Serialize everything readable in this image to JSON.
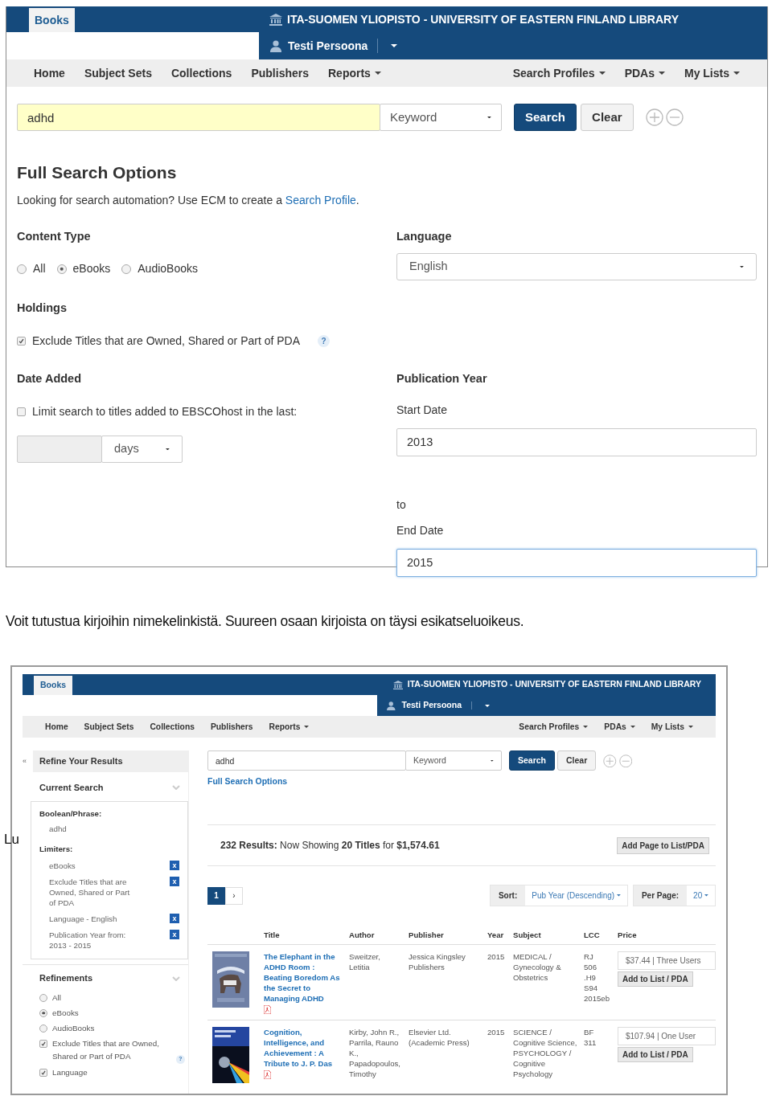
{
  "screen_1": {
    "header": {
      "tab": "Books",
      "library": "ITA-SUOMEN YLIOPISTO - UNIVERSITY OF EASTERN FINLAND LIBRARY",
      "user": "Testi Persoona"
    },
    "nav": {
      "left": [
        {
          "label": "Home",
          "dropdown": false
        },
        {
          "label": "Subject Sets",
          "dropdown": false
        },
        {
          "label": "Collections",
          "dropdown": false
        },
        {
          "label": "Publishers",
          "dropdown": false
        },
        {
          "label": "Reports",
          "dropdown": true
        }
      ],
      "right": [
        {
          "label": "Search Profiles",
          "dropdown": true
        },
        {
          "label": "PDAs",
          "dropdown": true
        },
        {
          "label": "My Lists",
          "dropdown": true
        }
      ]
    },
    "search": {
      "value": "adhd",
      "highlighted": true,
      "field_type": "Keyword",
      "search_button": "Search",
      "clear_button": "Clear"
    },
    "heading": "Full Search Options",
    "intro": "Looking for search automation? Use ECM to create a ",
    "intro_link": "Search Profile",
    "intro_end": ".",
    "content_type": {
      "label": "Content Type",
      "options": [
        {
          "label": "All",
          "selected": false
        },
        {
          "label": "eBooks",
          "selected": true
        },
        {
          "label": "AudioBooks",
          "selected": false
        }
      ]
    },
    "language": {
      "label": "Language",
      "value": "English"
    },
    "holdings": {
      "label": "Holdings",
      "option": {
        "label": "Exclude Titles that are Owned, Shared or Part of PDA",
        "checked": true
      },
      "help": "?"
    },
    "date_added": {
      "label": "Date Added",
      "option": {
        "label": "Limit search to titles added to EBSCOhost in the last:",
        "checked": false
      },
      "unit": "days"
    },
    "publication_year": {
      "label": "Publication Year",
      "start_label": "Start Date",
      "start": "2013",
      "to": "to",
      "end_label": "End Date",
      "end": "2015",
      "end_focused": true
    }
  },
  "caption": "Voit tutustua kirjoihin nimekelinkistä. Suureen osaan kirjoista on täysi esikatseluoikeus.",
  "stray_text": "Lu",
  "screen_2": {
    "header": {
      "tab": "Books",
      "library": "ITA-SUOMEN YLIOPISTO - UNIVERSITY OF EASTERN FINLAND LIBRARY",
      "user": "Testi Persoona"
    },
    "nav": {
      "left": [
        {
          "label": "Home",
          "dropdown": false
        },
        {
          "label": "Subject Sets",
          "dropdown": false
        },
        {
          "label": "Collections",
          "dropdown": false
        },
        {
          "label": "Publishers",
          "dropdown": false
        },
        {
          "label": "Reports",
          "dropdown": true
        }
      ],
      "right": [
        {
          "label": "Search Profiles",
          "dropdown": true
        },
        {
          "label": "PDAs",
          "dropdown": true
        },
        {
          "label": "My Lists",
          "dropdown": true
        }
      ]
    },
    "sidebar": {
      "collapse": "«",
      "title": "Refine Your Results",
      "current_search": "Current Search",
      "boolean_label": "Boolean/Phrase:",
      "boolean_value": "adhd",
      "limiters_label": "Limiters:",
      "limiters": [
        {
          "label": "eBooks",
          "remove": "x"
        },
        {
          "label": "Exclude Titles that are Owned, Shared or Part of PDA",
          "remove": "x"
        },
        {
          "label": "Language - English",
          "remove": "x"
        },
        {
          "label": "Publication Year from: 2013 - 2015",
          "remove": "x"
        }
      ],
      "refinements": "Refinements",
      "options": [
        {
          "kind": "radio",
          "label": "All",
          "selected": false
        },
        {
          "kind": "radio",
          "label": "eBooks",
          "selected": true
        },
        {
          "kind": "radio",
          "label": "AudioBooks",
          "selected": false
        },
        {
          "kind": "checkbox",
          "label": "Exclude Titles that are Owned, Shared or Part of PDA",
          "checked": true,
          "help": "?"
        },
        {
          "kind": "checkbox",
          "label": "Language",
          "checked": true
        }
      ]
    },
    "search": {
      "value": "adhd",
      "highlighted": false,
      "field_type": "Keyword",
      "search_button": "Search",
      "clear_button": "Clear"
    },
    "full_search_link": "Full Search Options",
    "summary": "**232 Results:** Now Showing **20 Titles** for **$1,574.61**",
    "add_page": "Add Page to List/PDA",
    "pagination": {
      "pages": [
        {
          "label": "1",
          "selected": true
        }
      ],
      "next": "›"
    },
    "sort": {
      "label": "Sort:",
      "value": "Pub Year (Descending)",
      "per_page_label": "Per Page:",
      "per_page": "20"
    },
    "columns": [
      "Title",
      "Author",
      "Publisher",
      "Year",
      "Subject",
      "LCC",
      "Price"
    ],
    "rows": [
      {
        "title": "The Elephant in the ADHD Room : Beating Boredom As the Secret to Managing ADHD",
        "author": "Sweitzer, Letitia",
        "publisher": "Jessica Kingsley Publishers",
        "year": "2015",
        "subject": "MEDICAL / Gynecology & Obstetrics",
        "lcc": "RJ 506 .H9 S94 2015eb",
        "price": "$37.44 | Three Users",
        "add": "Add to List / PDA"
      },
      {
        "title": "Cognition, Intelligence, and Achievement : A Tribute to J. P. Das",
        "author": "Kirby, John R., Parrila, Rauno K., Papadopoulos, Timothy",
        "publisher": "Elsevier Ltd. (Academic Press)",
        "year": "2015",
        "subject": "SCIENCE / Cognitive Science, PSYCHOLOGY / Cognitive Psychology",
        "lcc": "BF 311",
        "price": "$107.94 | One User",
        "add": "Add to List / PDA"
      }
    ]
  }
}
